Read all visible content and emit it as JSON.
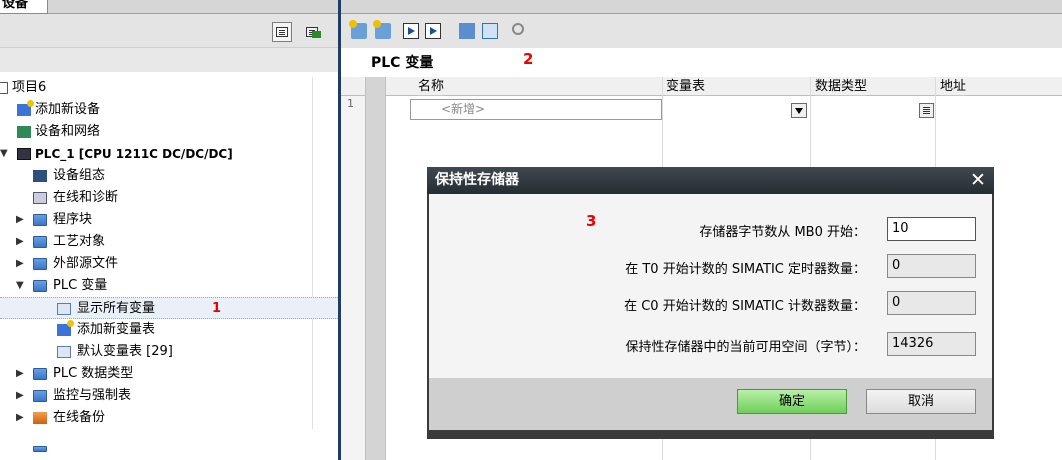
{
  "left_panel": {
    "tab_label": "设备",
    "tree": [
      {
        "label": "项目6",
        "icon": "project-icon"
      },
      {
        "label": "添加新设备",
        "icon": "add-device-icon"
      },
      {
        "label": "设备和网络",
        "icon": "network-icon"
      },
      {
        "label": "PLC_1 [CPU 1211C DC/DC/DC]",
        "icon": "plc-icon"
      },
      {
        "label": "设备组态",
        "icon": "device-config-icon"
      },
      {
        "label": "在线和诊断",
        "icon": "diagnostics-icon"
      },
      {
        "label": "程序块",
        "icon": "folder-icon"
      },
      {
        "label": "工艺对象",
        "icon": "folder-icon"
      },
      {
        "label": "外部源文件",
        "icon": "folder-icon"
      },
      {
        "label": "PLC 变量",
        "icon": "folder-icon"
      },
      {
        "label": "显示所有变量",
        "icon": "tag-table-icon"
      },
      {
        "label": "添加新变量表",
        "icon": "add-table-icon"
      },
      {
        "label": "默认变量表 [29]",
        "icon": "tag-table-icon"
      },
      {
        "label": "PLC 数据类型",
        "icon": "folder-icon"
      },
      {
        "label": "监控与强制表",
        "icon": "folder-icon"
      },
      {
        "label": "在线备份",
        "icon": "folder-icon"
      }
    ],
    "marker": "1"
  },
  "editor": {
    "title": "PLC 变量",
    "marker": "2",
    "columns": [
      "名称",
      "变量表",
      "数据类型",
      "地址"
    ],
    "row_number": "1",
    "new_placeholder": "<新增>"
  },
  "dialog": {
    "title": "保持性存储器",
    "marker": "3",
    "close_glyph": "✕",
    "fields": [
      {
        "label": "存储器字节数从 MB0 开始：",
        "value": "10"
      },
      {
        "label": "在 T0 开始计数的 SIMATIC 定时器数量：",
        "value": "0"
      },
      {
        "label": "在 C0 开始计数的 SIMATIC 计数器数量：",
        "value": "0"
      },
      {
        "label": "保持性存储器中的当前可用空间（字节）：",
        "value": "14326"
      }
    ],
    "ok_label": "确定",
    "cancel_label": "取消"
  },
  "colors": {
    "divider": "#1e3c64",
    "ok_button": "#6fcf5a",
    "marker": "#e00000"
  }
}
